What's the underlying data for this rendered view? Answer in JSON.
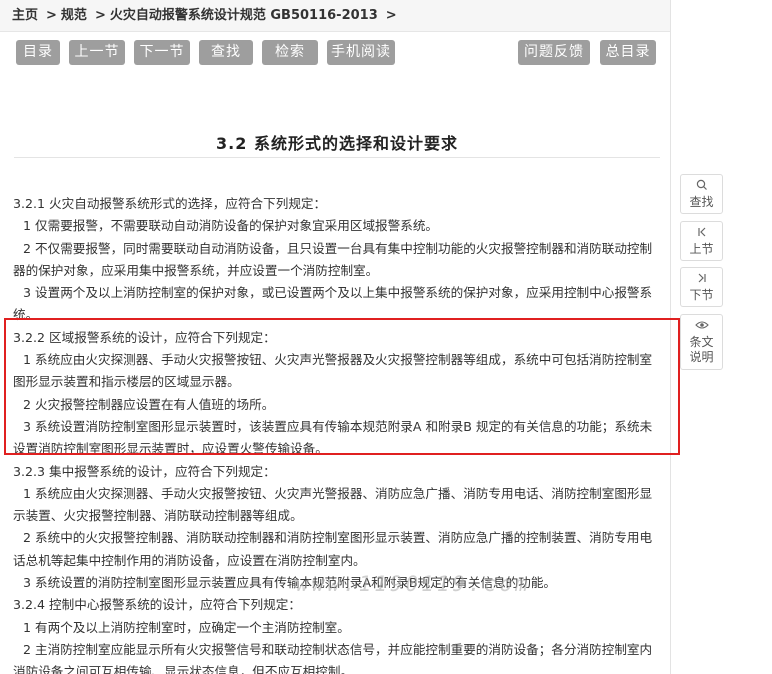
{
  "breadcrumb": {
    "home": "主页",
    "sep1": ">",
    "norms": "规范",
    "sep2": ">",
    "current": "火灾自动报警系统设计规范 GB50116-2013",
    "sep3": ">"
  },
  "toolbar": {
    "toc": "目录",
    "prev": "上一节",
    "next": "下一节",
    "find": "查找",
    "search": "检索",
    "mobile": "手机阅读",
    "feedback": "问题反馈",
    "catalog": "总目录"
  },
  "section_title": "3.2 系统形式的选择和设计要求",
  "paragraphs": [
    "3.2.1 火灾自动报警系统形式的选择，应符合下列规定：",
    "1 仅需要报警，不需要联动自动消防设备的保护对象宜采用区域报警系统。",
    "2 不仅需要报警，同时需要联动自动消防设备，且只设置一台具有集中控制功能的火灾报警控制器和消防联动控制器的保护对象，应采用集中报警系统，并应设置一个消防控制室。",
    "3 设置两个及以上消防控制室的保护对象，或已设置两个及以上集中报警系统的保护对象，应采用控制中心报警系统。",
    "3.2.2 区域报警系统的设计，应符合下列规定：",
    "1 系统应由火灾探测器、手动火灾报警按钮、火灾声光警报器及火灾报警控制器等组成，系统中可包括消防控制室图形显示装置和指示楼层的区域显示器。",
    "2 火灾报警控制器应设置在有人值班的场所。",
    "3 系统设置消防控制室图形显示装置时，该装置应具有传输本规范附录A 和附录B 规定的有关信息的功能；系统未设置消防控制室图形显示装置时，应设置火警传输设备。",
    "3.2.3 集中报警系统的设计，应符合下列规定：",
    "1 系统应由火灾探测器、手动火灾报警按钮、火灾声光警报器、消防应急广播、消防专用电话、消防控制室图形显示装置、火灾报警控制器、消防联动控制器等组成。",
    "2 系统中的火灾报警控制器、消防联动控制器和消防控制室图形显示装置、消防应急广播的控制装置、消防专用电话总机等起集中控制作用的消防设备，应设置在消防控制室内。",
    "3 系统设置的消防控制室图形显示装置应具有传输本规范附录A和附录B规定的有关信息的功能。",
    "3.2.4 控制中心报警系统的设计，应符合下列规定：",
    "1 有两个及以上消防控制室时，应确定一个主消防控制室。",
    "2 主消防控制室应能显示所有火灾报警信号和联动控制状态信号，并应能控制重要的消防设备；各分消防控制室内消防设备之间可互相传输、显示状态信息，但不应互相控制。"
  ],
  "watermark": "www.1190119.com",
  "sidebar": {
    "find": "查找",
    "prev": "上节",
    "next": "下节",
    "explain": "条文说明"
  },
  "colors": {
    "button_bg": "#9e9e9e",
    "highlight_border": "#e02020"
  }
}
